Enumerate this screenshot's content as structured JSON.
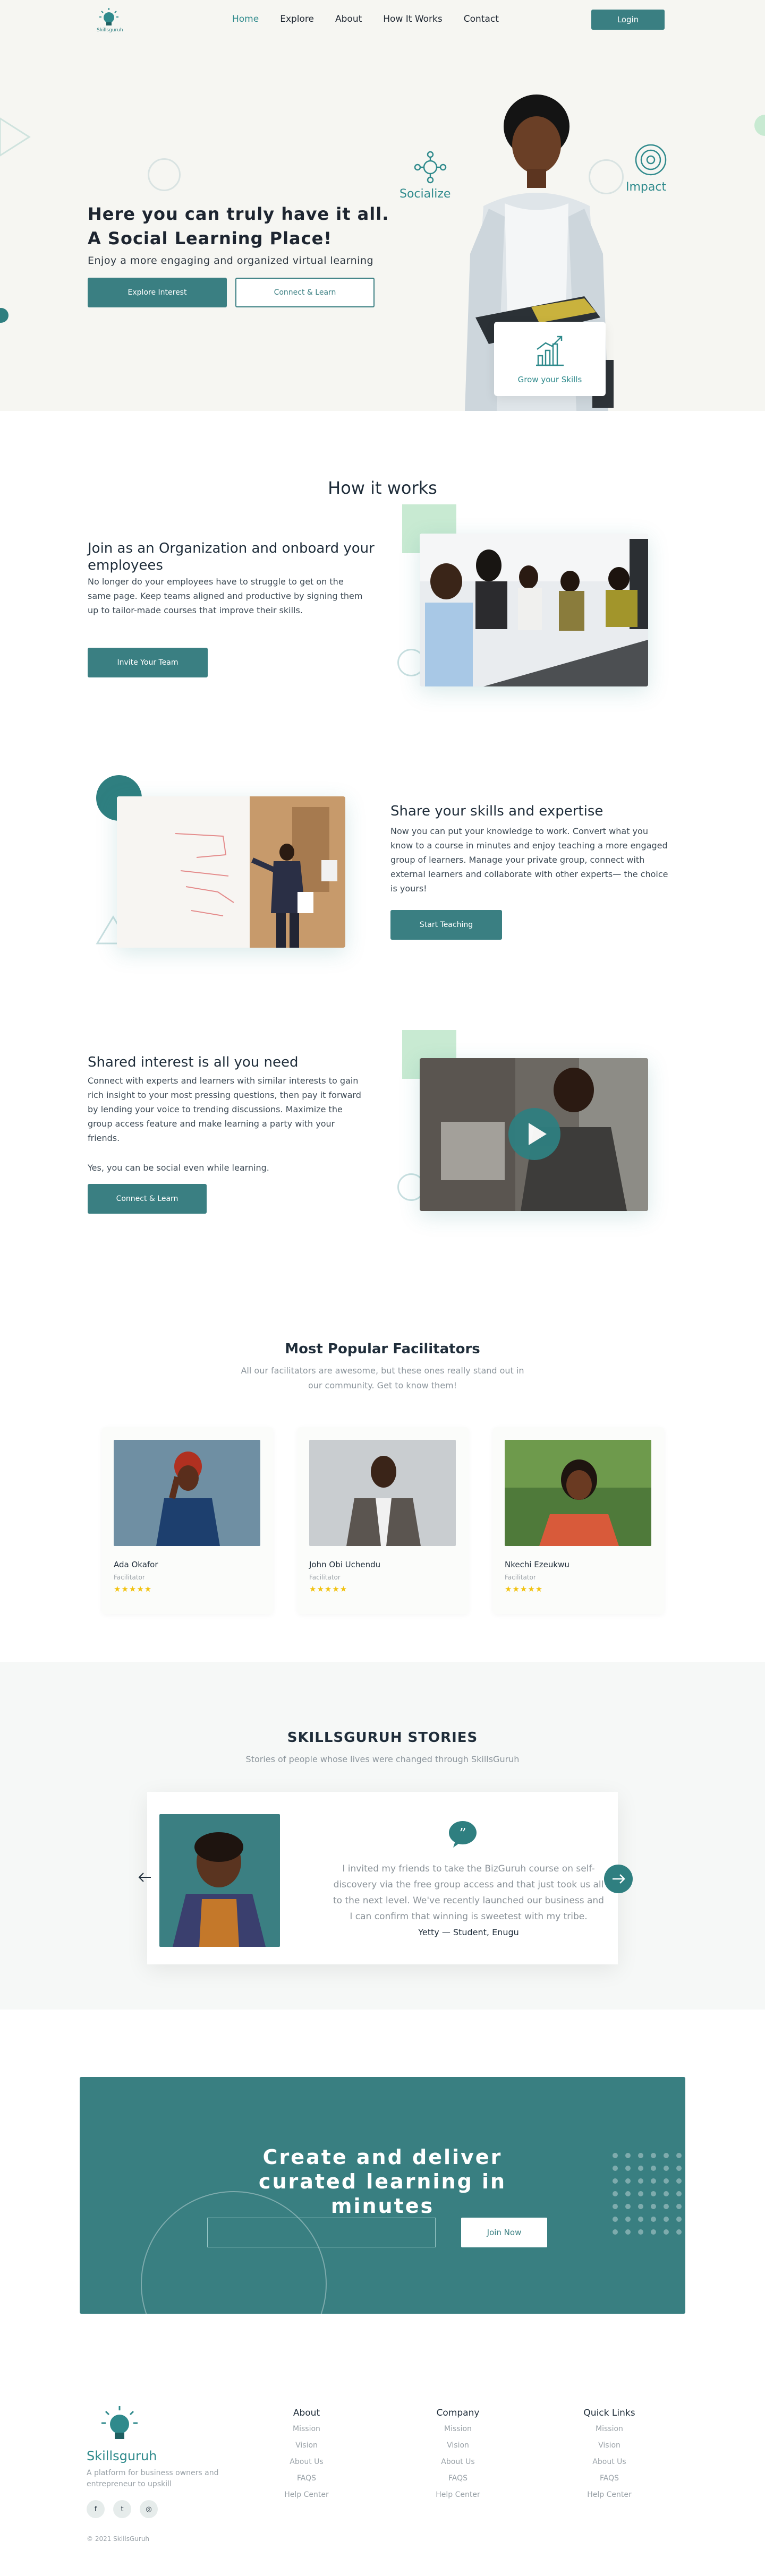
{
  "nav": {
    "brand": "Skillsguruh",
    "links": [
      "Home",
      "Explore",
      "About",
      "How It Works",
      "Contact"
    ],
    "login": "Login"
  },
  "hero": {
    "title": "Here you can truly have it all. A Social Learning Place!",
    "subtitle": "Enjoy a more engaging and organized virtual learning",
    "explore_btn": "Explore Interest",
    "connect_btn": "Connect & Learn",
    "tag_socialize": "Socialize",
    "tag_impact": "Impact",
    "tag_grow": "Grow your Skills"
  },
  "how": {
    "title": "How it works",
    "features": [
      {
        "title": "Join as an Organization and onboard your employees",
        "text": "No longer do your employees have to struggle to get on the same page. Keep teams aligned and productive by signing them up to tailor-made courses that improve their skills.",
        "button": "Invite Your Team"
      },
      {
        "title": "Share your skills and expertise",
        "text": "Now you can put your knowledge to work. Convert what you know to a course in minutes and enjoy teaching a more engaged group of learners. Manage your private group, connect with external learners and collaborate with other experts— the choice is yours!",
        "button": "Start Teaching"
      },
      {
        "title": "Shared interest is all you need",
        "text": "Connect with experts and learners with similar interests to gain rich insight to your most pressing questions, then pay it forward by lending your voice to trending discussions. Maximize the group access feature and make learning a party with your friends.",
        "text2": "Yes, you can be social even while learning.",
        "button": "Connect & Learn"
      }
    ]
  },
  "facilitators": {
    "title": "Most Popular Facilitators",
    "subtitle": "All our facilitators are awesome, but these ones really stand out in our community. Get to know them!",
    "items": [
      {
        "name": "Ada Okafor",
        "role": "Facilitator",
        "stars": "★★★★★"
      },
      {
        "name": "John Obi Uchendu",
        "role": "Facilitator",
        "stars": "★★★★★"
      },
      {
        "name": "Nkechi Ezeukwu",
        "role": "Facilitator",
        "stars": "★★★★★"
      }
    ]
  },
  "stories": {
    "title": "SKILLSGURUH STORIES",
    "subtitle": "Stories of people whose lives were changed through SkillsGuruh",
    "quote": "I invited my friends to take the BizGuruh course on self-discovery via the free group access and that just took us all to the next level. We've recently launched our business and I can confirm that winning is sweetest with my tribe.",
    "author": "Yetty — Student, Enugu"
  },
  "cta": {
    "title": "Create and deliver curated learning in minutes",
    "input_placeholder": "",
    "button": "Join Now"
  },
  "footer": {
    "brand": "Skillsguruh",
    "description": "A platform for business owners and entrepreneur to upskill",
    "columns": [
      {
        "title": "About",
        "items": [
          "Mission",
          "Vision",
          "About Us",
          "FAQS",
          "Help Center"
        ]
      },
      {
        "title": "Company",
        "items": [
          "Mission",
          "Vision",
          "About Us",
          "FAQS",
          "Help Center"
        ]
      },
      {
        "title": "Quick Links",
        "items": [
          "Mission",
          "Vision",
          "About Us",
          "FAQS",
          "Help Center"
        ]
      }
    ],
    "copyright": "© 2021 SkillsGuruh"
  },
  "colors": {
    "primary": "#3a7f82",
    "accent_green": "#c8ead2",
    "star": "#f2c20e"
  }
}
